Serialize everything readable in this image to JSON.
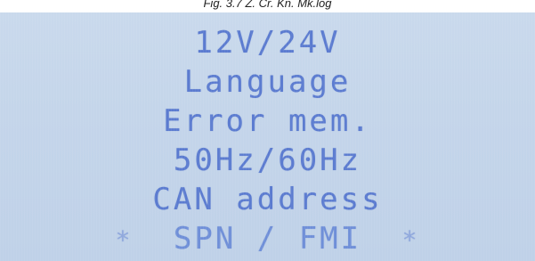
{
  "caption": "Fig. 3.7 Z. Cr. Kn. Mk.log",
  "lcd": {
    "items": [
      {
        "label": "12V/24V"
      },
      {
        "label": "Language"
      },
      {
        "label": "Error mem."
      },
      {
        "label": "50Hz/60Hz"
      },
      {
        "label": "CAN address"
      },
      {
        "label": "SPN / FMI",
        "selected": true
      }
    ],
    "selection_marker": "*"
  },
  "colors": {
    "lcd_background": "#c4d5ea",
    "lcd_text": "#5b7bd0"
  }
}
